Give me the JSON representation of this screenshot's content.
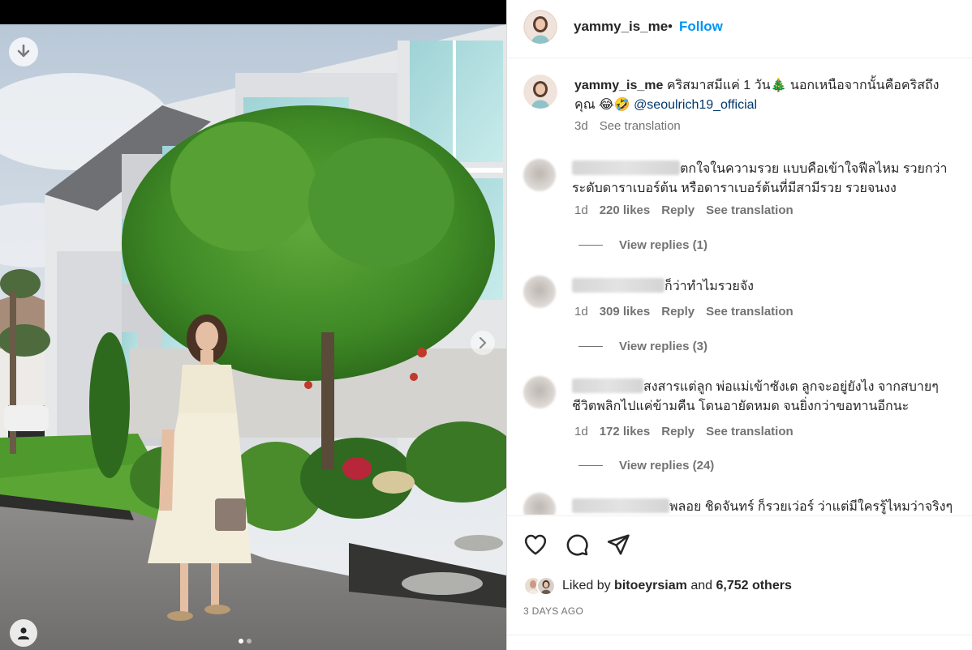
{
  "post": {
    "username": "yammy_is_me",
    "separator": "•",
    "follow_label": "Follow",
    "caption_text": "คริสมาสมีแค่ 1 วัน🎄 นอกเหนือจากนั้นคือคริสถึงคุณ 😂🤣 ",
    "caption_mention": "@seoulrich19_official",
    "caption_age": "3d",
    "see_translation": "See translation"
  },
  "comments": [
    {
      "text": "ตกใจในความรวย แบบคือเข้าใจฟีลไหม รวยกว่า ระดับดาราเบอร์ต้น หรือดาราเบอร์ต้นที่มีสามีรวย รวยจนงง",
      "age": "1d",
      "likes": "220 likes",
      "reply": "Reply",
      "see_translation": "See translation",
      "view_replies": "View replies (1)"
    },
    {
      "text": "ก็ว่าทำไมรวยจัง",
      "age": "1d",
      "likes": "309 likes",
      "reply": "Reply",
      "see_translation": "See translation",
      "view_replies": "View replies (3)"
    },
    {
      "text": "สงสารแต่ลูก พ่อแม่เข้าซังเต ลูกจะอยู่ยังไง จากสบายๆ ชีวิตพลิกไปแค่ข้ามคืน โดนอายัดหมด จนยิ่งกว่าขอทานอีกนะ",
      "age": "1d",
      "likes": "172 likes",
      "reply": "Reply",
      "see_translation": "See translation",
      "view_replies": "View replies (24)"
    },
    {
      "text": "พลอย ชิดจันทร์ ก็รวยเว่อร์ ว่าแต่มีใครรู้ไหมว่าจริงๆ"
    }
  ],
  "actions": {
    "like_icon": "heart-icon",
    "comment_icon": "comment-icon",
    "share_icon": "share-icon"
  },
  "likes": {
    "prefix": "Liked by",
    "user": "bitoeyrsiam",
    "joiner": "and",
    "others": "6,752 others"
  },
  "date_label": "3 DAYS AGO",
  "colors": {
    "accent_blue": "#0095f6",
    "mention_blue": "#00376b",
    "secondary_text": "#737373",
    "primary_text": "#262626"
  }
}
